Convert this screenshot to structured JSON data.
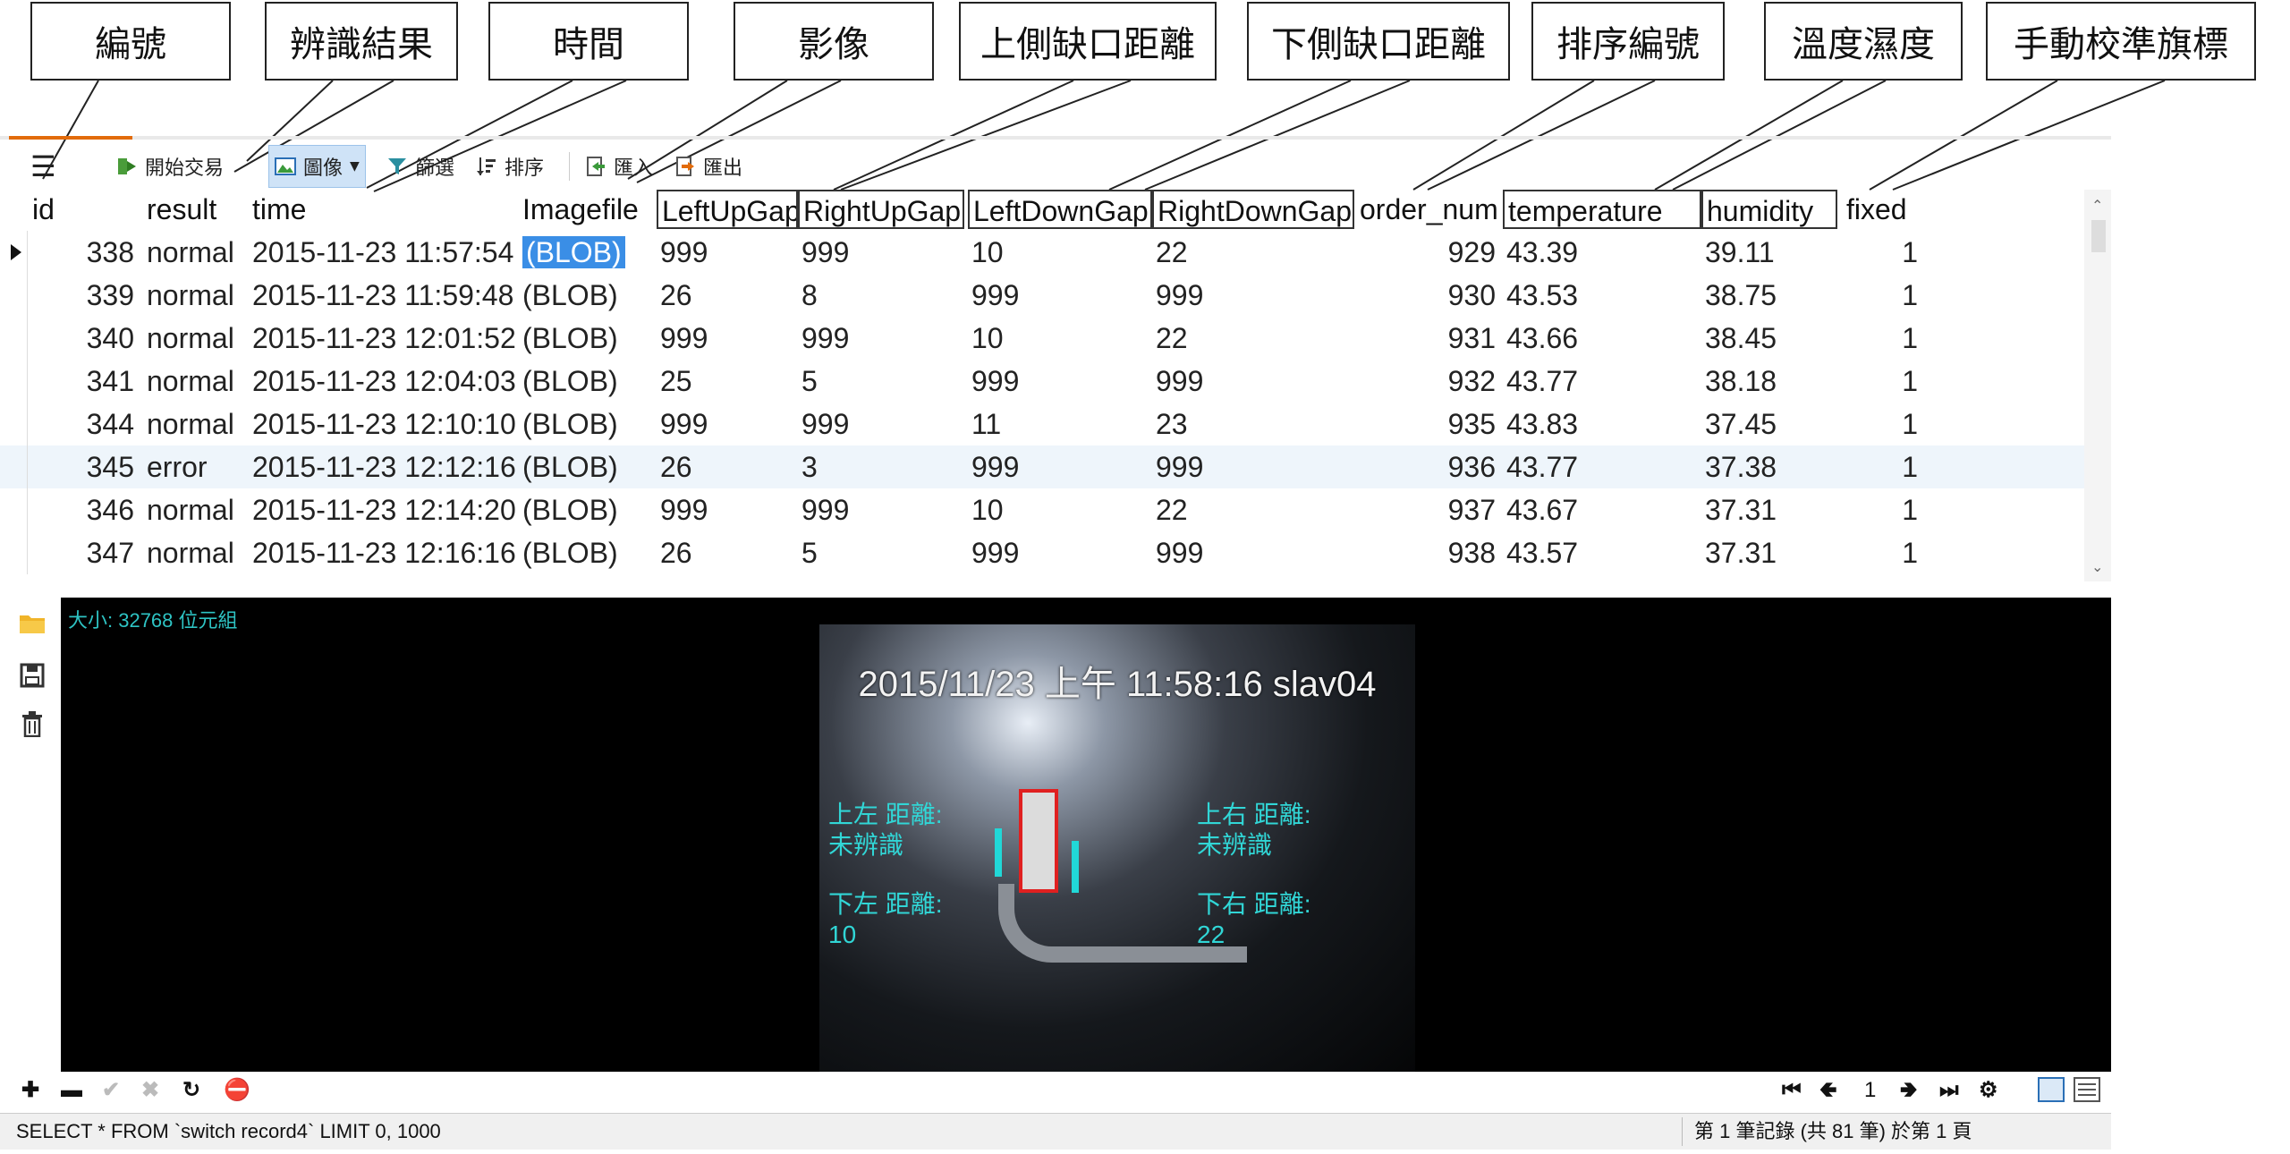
{
  "annotations": [
    "編號",
    "辨識結果",
    "時間",
    "影像",
    "上側缺口距離",
    "下側缺口距離",
    "排序編號",
    "溫度濕度",
    "手動校準旗標"
  ],
  "toolbar": {
    "menu_icon": "hamburger-icon",
    "begin_transaction": "開始交易",
    "image": "圖像",
    "filter": "篩選",
    "sort": "排序",
    "import": "匯入",
    "export": "匯出"
  },
  "table": {
    "columns": [
      "id",
      "result",
      "time",
      "Imagefile",
      "LeftUpGap",
      "RightUpGap",
      "LeftDownGap",
      "RightDownGap",
      "order_num",
      "temperature",
      "humidity",
      "fixed"
    ],
    "rows": [
      [
        "338",
        "normal",
        "2015-11-23 11:57:54",
        "(BLOB)",
        "999",
        "999",
        "10",
        "22",
        "929",
        "43.39",
        "39.11",
        "1"
      ],
      [
        "339",
        "normal",
        "2015-11-23 11:59:48",
        "(BLOB)",
        "26",
        "8",
        "999",
        "999",
        "930",
        "43.53",
        "38.75",
        "1"
      ],
      [
        "340",
        "normal",
        "2015-11-23 12:01:52",
        "(BLOB)",
        "999",
        "999",
        "10",
        "22",
        "931",
        "43.66",
        "38.45",
        "1"
      ],
      [
        "341",
        "normal",
        "2015-11-23 12:04:03",
        "(BLOB)",
        "25",
        "5",
        "999",
        "999",
        "932",
        "43.77",
        "38.18",
        "1"
      ],
      [
        "344",
        "normal",
        "2015-11-23 12:10:10",
        "(BLOB)",
        "999",
        "999",
        "11",
        "23",
        "935",
        "43.83",
        "37.45",
        "1"
      ],
      [
        "345",
        "error",
        "2015-11-23 12:12:16",
        "(BLOB)",
        "26",
        "3",
        "999",
        "999",
        "936",
        "43.77",
        "37.38",
        "1"
      ],
      [
        "346",
        "normal",
        "2015-11-23 12:14:20",
        "(BLOB)",
        "999",
        "999",
        "10",
        "22",
        "937",
        "43.67",
        "37.31",
        "1"
      ],
      [
        "347",
        "normal",
        "2015-11-23 12:16:16",
        "(BLOB)",
        "26",
        "5",
        "999",
        "999",
        "938",
        "43.57",
        "37.31",
        "1"
      ]
    ]
  },
  "viewer": {
    "size_label": "大小: 32768 位元組",
    "timestamp": "2015/11/23 上午 11:58:16 slav04",
    "upper_left_label": "上左 距離:",
    "upper_left_value": "未辨識",
    "upper_right_label": "上右 距離:",
    "upper_right_value": "未辨識",
    "lower_left_label": "下左 距離:",
    "lower_left_value": "10",
    "lower_right_label": "下右 距離:",
    "lower_right_value": "22"
  },
  "nav": {
    "page": "1"
  },
  "status": {
    "sql": "SELECT * FROM `switch record4` LIMIT 0, 1000",
    "record_info": "第 1 筆記錄 (共 81 筆) 於第 1 頁"
  },
  "colors": {
    "accent": "#e26b0a",
    "selection": "#3a8ee6",
    "overlay_text": "#31d6d6",
    "mark_box": "#e02020"
  }
}
